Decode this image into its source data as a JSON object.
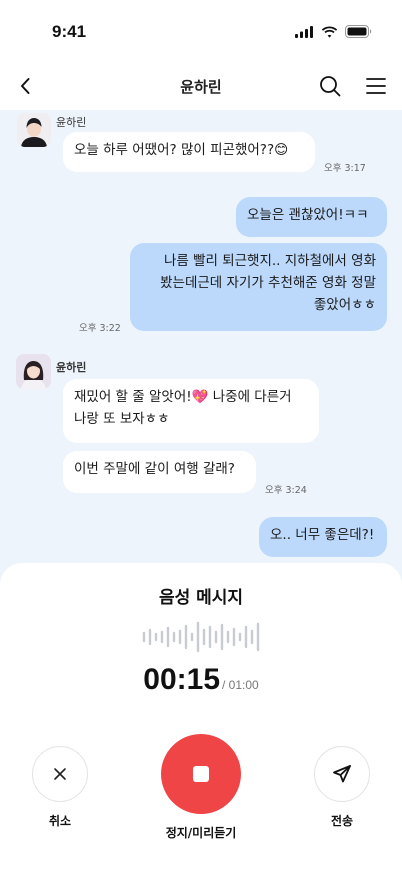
{
  "status_bar": {
    "time": "9:41",
    "icons": [
      "cellular-icon",
      "wifi-icon",
      "battery-icon"
    ]
  },
  "header": {
    "title": "윤하린",
    "back_icon": "chevron-left-icon",
    "search_icon": "search-icon",
    "menu_icon": "hamburger-icon"
  },
  "messages": [
    {
      "sender": "윤하린",
      "direction": "incoming",
      "text": "오늘 하루 어땠어? 많이 피곤했어??😊",
      "time": "오후 3:17"
    },
    {
      "direction": "outgoing",
      "text": "오늘은 괜찮았어!ㅋㅋ"
    },
    {
      "direction": "outgoing",
      "text": "나름 빨리 퇴근햇지.. 지하철에서 영화\n봤는데근데 자기가 추천해준 영화 정말\n좋았어ㅎㅎ",
      "time": "오후 3:22"
    },
    {
      "sender": "윤하린",
      "direction": "incoming",
      "text": "재밌어 할 줄 알앗어!💖 나중에 다른거\n나랑 또 보자ㅎㅎ"
    },
    {
      "direction": "incoming",
      "text": "이번 주말에 같이 여행 갈래?",
      "time": "오후 3:24"
    },
    {
      "direction": "outgoing",
      "text": "오.. 너무 좋은데?!"
    }
  ],
  "voice_sheet": {
    "title": "음성 메시지",
    "elapsed": "00:15",
    "max_duration": "/ 01:00",
    "cancel_label": "취소",
    "stop_label": "정지/미리듣기",
    "send_label": "전송",
    "record_color": "#ef4547"
  }
}
